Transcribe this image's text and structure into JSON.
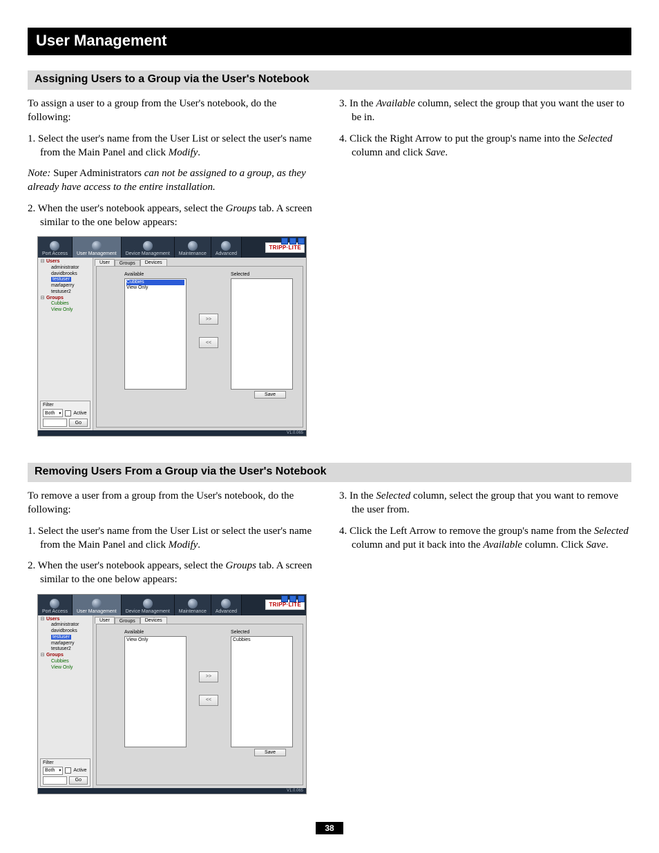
{
  "chapter": "User Management",
  "section1": {
    "heading": "Assigning Users to a Group via the User's Notebook",
    "left": {
      "intro": "To assign a user to a group from the User's notebook, do the following:",
      "step1_a": "1. Select the user's name from the User List or select the user's name from the Main Panel and click ",
      "step1_b": "Modify",
      "step1_c": ".",
      "note_a": "Note:",
      "note_b": " Super Administrators ",
      "note_c": "can not be assigned to a group, as they already have access to the entire installation.",
      "step2_a": "2. When the user's notebook appears, select the ",
      "step2_b": "Groups",
      "step2_c": " tab. A screen similar to the one below appears:"
    },
    "right": {
      "step3_a": "3. In the ",
      "step3_b": "Available",
      "step3_c": " column, select the group that you want the user to be in.",
      "step4_a": "4. Click the Right Arrow to put the group's name into the ",
      "step4_b": "Selected",
      "step4_c": " column and click ",
      "step4_d": "Save",
      "step4_e": "."
    }
  },
  "section2": {
    "heading": "Removing Users From a Group via the User's Notebook",
    "left": {
      "intro": "To remove a user from a group from the User's notebook, do the following:",
      "step1_a": "1. Select the user's name from the User List or select the user's name from the Main Panel and click ",
      "step1_b": "Modify",
      "step1_c": ".",
      "step2_a": "2. When the user's notebook appears, select the ",
      "step2_b": "Groups",
      "step2_c": " tab. A screen similar to the one below appears:"
    },
    "right": {
      "step3_a": "3. In the ",
      "step3_b": "Selected",
      "step3_c": " column, select the group that you want to remove the user from.",
      "step4_a": "4. Click the Left Arrow to remove the group's name from the ",
      "step4_b": "Selected",
      "step4_c": " column and put it back into the ",
      "step4_d": "Available",
      "step4_e": " column. Click ",
      "step4_f": "Save",
      "step4_g": "."
    }
  },
  "screenshot": {
    "tabs": {
      "port": "Port Access",
      "user": "User Management",
      "device": "Device Management",
      "maint": "Maintenance",
      "adv": "Advanced"
    },
    "logo": "TRIPP·LITE",
    "tree": {
      "users": "Users",
      "u1": "administrator",
      "u2": "davidbrooks",
      "u3": "testuser",
      "u4": "marlaperry",
      "u5": "testuser2",
      "groups": "Groups",
      "g1": "Cubbies",
      "g2": "View Only"
    },
    "filter": {
      "title": "Filter",
      "both": "Both",
      "active": "Active",
      "go": "Go"
    },
    "subtabs": {
      "user": "User",
      "groups": "Groups",
      "devices": "Devices"
    },
    "available": "Available",
    "selected": "Selected",
    "item_cubbies": "Cubbies",
    "item_viewonly": "View Only",
    "right_arrow": ">>",
    "left_arrow": "<<",
    "save": "Save",
    "version": "V1.0.065"
  },
  "page_number": "38"
}
